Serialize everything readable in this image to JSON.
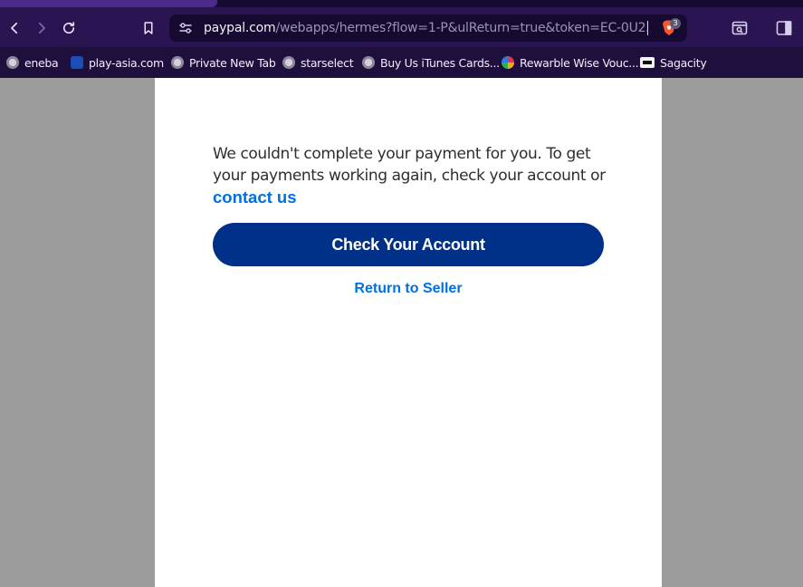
{
  "browser": {
    "url_host": "paypal.com",
    "url_path": "/webapps/hermes?flow=1-P&ulReturn=true&token=EC-0U2569...",
    "shield_count": "3",
    "nav_icons": [
      "back-icon",
      "forward-icon",
      "reload-icon",
      "bookmark-icon"
    ],
    "toolbar_icons": [
      "search-tabs-icon",
      "sidebar-icon"
    ]
  },
  "bookmarks": [
    {
      "label": "eneba",
      "icon": "globe-icon"
    },
    {
      "label": "play-asia.com",
      "icon": "play-asia-icon"
    },
    {
      "label": "Private New Tab",
      "icon": "globe-icon"
    },
    {
      "label": "starselect",
      "icon": "globe-icon"
    },
    {
      "label": "Buy Us iTunes Cards...",
      "icon": "globe-icon"
    },
    {
      "label": "Rewarble Wise Vouc...",
      "icon": "rewarble-icon"
    },
    {
      "label": "Sagacity",
      "icon": "sagacity-icon"
    }
  ],
  "page": {
    "message": "We couldn't complete your payment for you. To get your payments working again, check your account or",
    "contact_link": "contact us",
    "primary_button": "Check Your Account",
    "return_link": "Return to Seller"
  },
  "colors": {
    "chrome_bg": "#1f0f3d",
    "primary_button": "#003087",
    "link": "#0070e0",
    "backdrop": "#9b9b9b"
  }
}
